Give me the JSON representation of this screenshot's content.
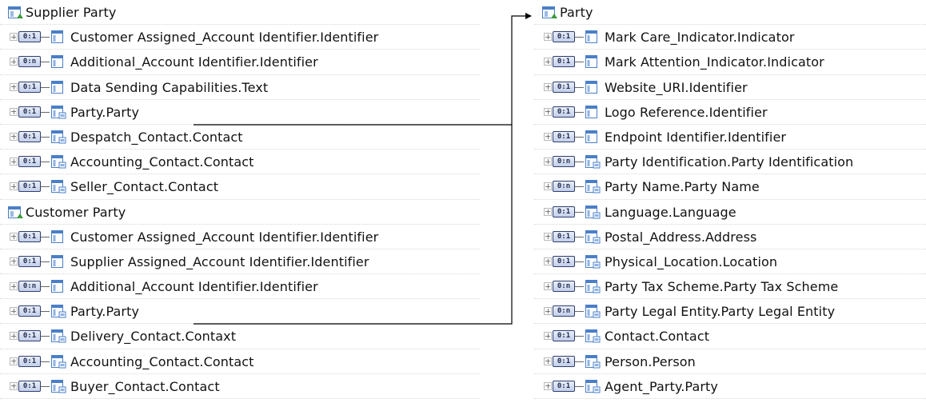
{
  "left_tree": [
    {
      "kind": "header",
      "label": "Supplier Party"
    },
    {
      "kind": "item",
      "card": "0:1",
      "icon": "basic-element-icon",
      "label": "Customer  Assigned_Account Identifier.Identifier"
    },
    {
      "kind": "item",
      "card": "0:n",
      "icon": "basic-element-icon",
      "label": "Additional_Account Identifier.Identifier"
    },
    {
      "kind": "item",
      "card": "0:1",
      "icon": "basic-element-icon",
      "label": "Data Sending Capabilities.Text"
    },
    {
      "kind": "item",
      "card": "0:1",
      "icon": "aggregate-element-icon",
      "label": "Party.Party"
    },
    {
      "kind": "item",
      "card": "0:1",
      "icon": "aggregate-element-icon",
      "label": "Despatch_Contact.Contact"
    },
    {
      "kind": "item",
      "card": "0:1",
      "icon": "aggregate-element-icon",
      "label": "Accounting_Contact.Contact"
    },
    {
      "kind": "item",
      "card": "0:1",
      "icon": "aggregate-element-icon",
      "label": "Seller_Contact.Contact"
    },
    {
      "kind": "header",
      "label": "Customer Party"
    },
    {
      "kind": "item",
      "card": "0:1",
      "icon": "basic-element-icon",
      "label": "Customer  Assigned_Account Identifier.Identifier"
    },
    {
      "kind": "item",
      "card": "0:1",
      "icon": "basic-element-icon",
      "label": "Supplier Assigned_Account Identifier.Identifier"
    },
    {
      "kind": "item",
      "card": "0:n",
      "icon": "basic-element-icon",
      "label": "Additional_Account Identifier.Identifier"
    },
    {
      "kind": "item",
      "card": "0:1",
      "icon": "aggregate-element-icon",
      "label": "Party.Party"
    },
    {
      "kind": "item",
      "card": "0:1",
      "icon": "aggregate-element-icon",
      "label": "Delivery_Contact.Contaxt"
    },
    {
      "kind": "item",
      "card": "0:1",
      "icon": "aggregate-element-icon",
      "label": "Accounting_Contact.Contact"
    },
    {
      "kind": "item",
      "card": "0:1",
      "icon": "aggregate-element-icon",
      "label": "Buyer_Contact.Contact"
    }
  ],
  "right_tree": [
    {
      "kind": "header",
      "label": "Party"
    },
    {
      "kind": "item",
      "card": "0:1",
      "icon": "basic-element-icon",
      "label": "Mark Care_Indicator.Indicator"
    },
    {
      "kind": "item",
      "card": "0:1",
      "icon": "basic-element-icon",
      "label": "Mark  Attention_Indicator.Indicator"
    },
    {
      "kind": "item",
      "card": "0:1",
      "icon": "basic-element-icon",
      "label": "Website_URI.Identifier"
    },
    {
      "kind": "item",
      "card": "0:1",
      "icon": "basic-element-icon",
      "label": "Logo Reference.Identifier"
    },
    {
      "kind": "item",
      "card": "0:1",
      "icon": "basic-element-icon",
      "label": "Endpoint Identifier.Identifier"
    },
    {
      "kind": "item",
      "card": "0:n",
      "icon": "aggregate-element-icon",
      "label": "Party  Identification.Party Identification"
    },
    {
      "kind": "item",
      "card": "0:n",
      "icon": "aggregate-element-icon",
      "label": "Party Name.Party Name"
    },
    {
      "kind": "item",
      "card": "0:1",
      "icon": "aggregate-element-icon",
      "label": "Language.Language"
    },
    {
      "kind": "item",
      "card": "0:1",
      "icon": "aggregate-element-icon",
      "label": "Postal_Address.Address"
    },
    {
      "kind": "item",
      "card": "0:1",
      "icon": "aggregate-element-icon",
      "label": "Physical_Location.Location"
    },
    {
      "kind": "item",
      "card": "0:n",
      "icon": "aggregate-element-icon",
      "label": "Party Tax Scheme.Party Tax Scheme"
    },
    {
      "kind": "item",
      "card": "0:n",
      "icon": "aggregate-element-icon",
      "label": "Party Legal Entity.Party Legal Entity"
    },
    {
      "kind": "item",
      "card": "0:1",
      "icon": "aggregate-element-icon",
      "label": "Contact.Contact"
    },
    {
      "kind": "item",
      "card": "0:1",
      "icon": "aggregate-element-icon",
      "label": "Person.Person"
    },
    {
      "kind": "item",
      "card": "0:1",
      "icon": "aggregate-element-icon",
      "label": "Agent_Party.Party"
    }
  ],
  "colors": {
    "line": "#000000",
    "card_border": "#2f3e6f",
    "icon_blue": "#4a7fc7",
    "icon_green": "#3a9a3a"
  }
}
